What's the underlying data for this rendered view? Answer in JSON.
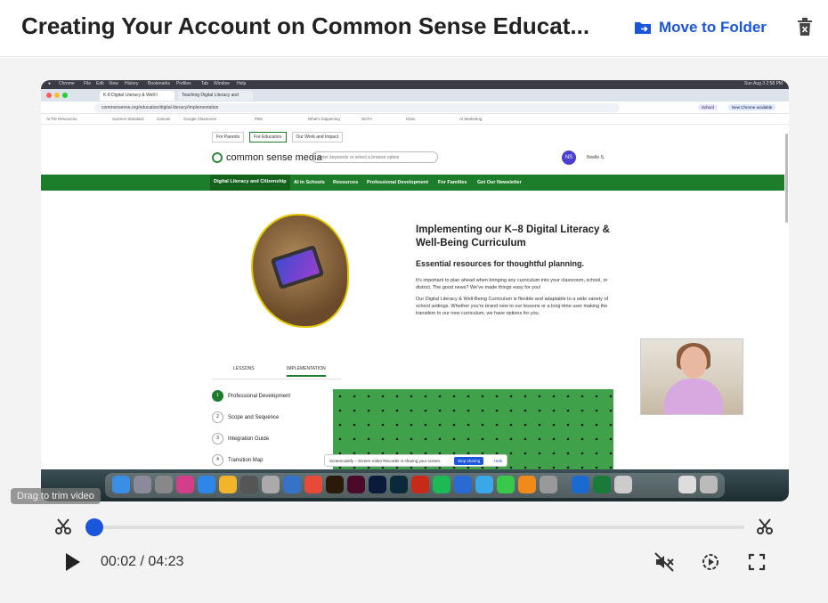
{
  "header": {
    "title": "Creating Your Account on Common Sense Educat...",
    "move_label": "Move to Folder"
  },
  "video_frame": {
    "menubar": [
      "Chrome",
      "File",
      "Edit",
      "View",
      "History",
      "Bookmarks",
      "Profiles",
      "Tab",
      "Window",
      "Help"
    ],
    "menubar_right": "Sun Aug 3  2:58 PM",
    "tabs": [
      "K-8 Digital Literacy & Well-I",
      "Teaching Digital Literacy and"
    ],
    "url": "commonsense.org/education/digital-literacy/implementation",
    "chrome_pills": [
      "School",
      "New Chrome available"
    ],
    "bookmarks": [
      "AI PD Resources",
      "Science Standard",
      "Canvas",
      "Google Classroom",
      "PBS",
      "What's happening",
      "NCFA",
      "Khan",
      "AI Marketing"
    ],
    "site_tabs": [
      "For Parents",
      "For Educators",
      "Our Work and Impact"
    ],
    "logo_text": "common sense media",
    "search_placeholder": "Enter keywords or select a browse option",
    "user_initials": "NS",
    "user_name": "Noelle S.",
    "nav": [
      "Digital Literacy and Citizenship",
      "AI in Schools",
      "Resources",
      "Professional Development",
      "For Families",
      "Get Our Newsletter"
    ],
    "hero_heading": "Implementing our K–8 Digital Literacy & Well-Being Curriculum",
    "hero_subheading": "Essential resources for thoughtful planning.",
    "hero_p1": "It's important to plan ahead when bringing any curriculum into your classroom, school, or district. The good news? We've made things easy for you!",
    "hero_p2": "Our Digital Literacy & Well-Being Curriculum is flexible and adaptable to a wide variety of school settings. Whether you're brand new to our lessons or a long-time user making the transition to our new curriculum, we have options for you.",
    "lesson_tabs": [
      "LESSONS",
      "IMPLEMENTATION"
    ],
    "steps": [
      {
        "num": "1",
        "label": "Professional Development"
      },
      {
        "num": "2",
        "label": "Scope and Sequence"
      },
      {
        "num": "3",
        "label": "Integration Guide"
      },
      {
        "num": "4",
        "label": "Transition Map"
      }
    ],
    "share_msg": "Screencastify – Screen Video Recorder is sharing your screen.",
    "share_stop": "Stop sharing",
    "share_hide": "Hide"
  },
  "controls": {
    "tooltip": "Drag to trim video",
    "time": "00:02 / 04:23",
    "progress": 0.008
  },
  "colors": {
    "accent": "#1a56db",
    "site_green": "#1e7d2a"
  }
}
